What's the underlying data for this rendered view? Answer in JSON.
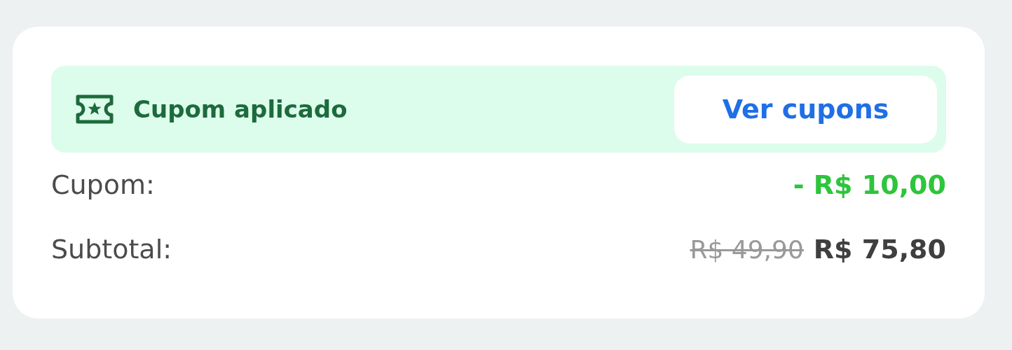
{
  "coupon_banner": {
    "status": "Cupom aplicado",
    "button": "Ver cupons"
  },
  "rows": [
    {
      "kind": "discount",
      "label": "Cupom:",
      "value": "- R$ 10,00"
    },
    {
      "kind": "total",
      "label": "Subtotal:",
      "old_value": "R$ 49,90",
      "value": "R$ 75,80"
    }
  ]
}
